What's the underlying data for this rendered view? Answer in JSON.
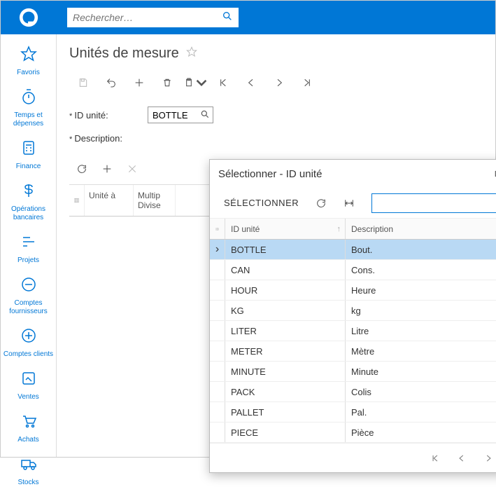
{
  "colors": {
    "primary": "#0077d6"
  },
  "topbar": {
    "search_placeholder": "Rechercher…"
  },
  "sidebar": {
    "items": [
      {
        "label": "Favoris",
        "icon": "star-icon"
      },
      {
        "label": "Temps et dépenses",
        "icon": "stopwatch-icon"
      },
      {
        "label": "Finance",
        "icon": "calculator-icon"
      },
      {
        "label": "Opérations bancaires",
        "icon": "dollar-icon"
      },
      {
        "label": "Projets",
        "icon": "gantt-icon"
      },
      {
        "label": "Comptes fournisseurs",
        "icon": "minus-circle-icon"
      },
      {
        "label": "Comptes clients",
        "icon": "plus-circle-icon"
      },
      {
        "label": "Ventes",
        "icon": "edit-icon"
      },
      {
        "label": "Achats",
        "icon": "cart-icon"
      },
      {
        "label": "Stocks",
        "icon": "truck-icon"
      }
    ]
  },
  "page": {
    "title": "Unités de mesure"
  },
  "form": {
    "id_label": "ID unité:",
    "id_value": "BOTTLE",
    "desc_label": "Description:"
  },
  "grid": {
    "col1": "Unité à",
    "col2": "Multip\nDivise"
  },
  "popup": {
    "title": "Sélectionner - ID unité",
    "select_label": "SÉLECTIONNER",
    "search_value": "",
    "col_id": "ID unité",
    "col_desc": "Description",
    "rows": [
      {
        "id": "BOTTLE",
        "desc": "Bout.",
        "selected": true
      },
      {
        "id": "CAN",
        "desc": "Cons.",
        "selected": false
      },
      {
        "id": "HOUR",
        "desc": "Heure",
        "selected": false
      },
      {
        "id": "KG",
        "desc": "kg",
        "selected": false
      },
      {
        "id": "LITER",
        "desc": "Litre",
        "selected": false
      },
      {
        "id": "METER",
        "desc": "Mètre",
        "selected": false
      },
      {
        "id": "MINUTE",
        "desc": "Minute",
        "selected": false
      },
      {
        "id": "PACK",
        "desc": "Colis",
        "selected": false
      },
      {
        "id": "PALLET",
        "desc": "Pal.",
        "selected": false
      },
      {
        "id": "PIECE",
        "desc": "Pièce",
        "selected": false
      }
    ]
  }
}
